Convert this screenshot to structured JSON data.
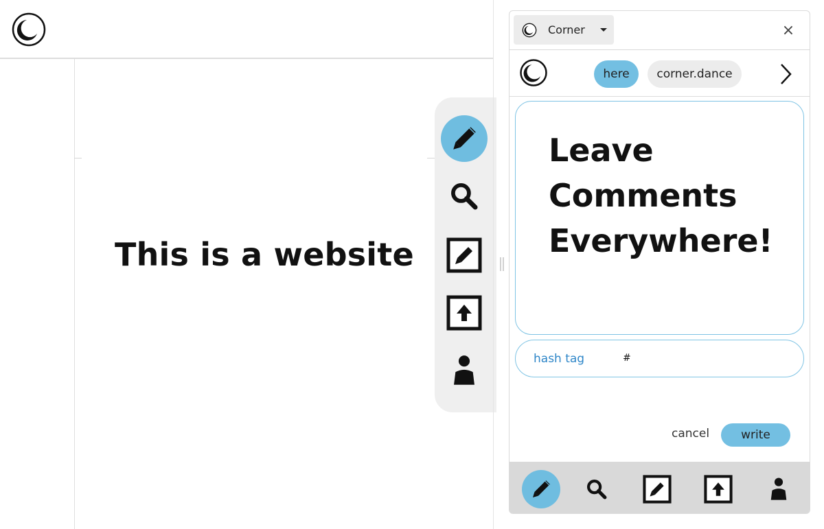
{
  "website": {
    "heading": "This is a website",
    "logo_icon": "crescent-moon-logo-icon"
  },
  "floating_toolbar": {
    "items": [
      {
        "icon": "pencil-icon",
        "active": true
      },
      {
        "icon": "search-icon",
        "active": false
      },
      {
        "icon": "edit-box-icon",
        "active": false
      },
      {
        "icon": "upload-box-icon",
        "active": false
      },
      {
        "icon": "user-icon",
        "active": false
      }
    ]
  },
  "panel": {
    "app_name": "Corner",
    "close_label": "×",
    "scope_chips": [
      {
        "label": "here",
        "selected": true
      },
      {
        "label": "corner.dance",
        "selected": false
      }
    ],
    "compose_text": "Leave Comments Everywhere!",
    "hashtag": {
      "label": "hash tag",
      "value": "#"
    },
    "cancel_label": "cancel",
    "write_label": "write",
    "bottom_nav": [
      {
        "icon": "pencil-icon",
        "active": true
      },
      {
        "icon": "search-icon",
        "active": false
      },
      {
        "icon": "edit-box-icon",
        "active": false
      },
      {
        "icon": "upload-box-icon",
        "active": false
      },
      {
        "icon": "user-icon",
        "active": false
      }
    ]
  },
  "colors": {
    "accent": "#6fbde0",
    "outline": "#7ec3e4",
    "hashtag_label": "#2e86c8",
    "toolbar_bg": "#efefef",
    "nav_bg": "#d9d9d9"
  }
}
